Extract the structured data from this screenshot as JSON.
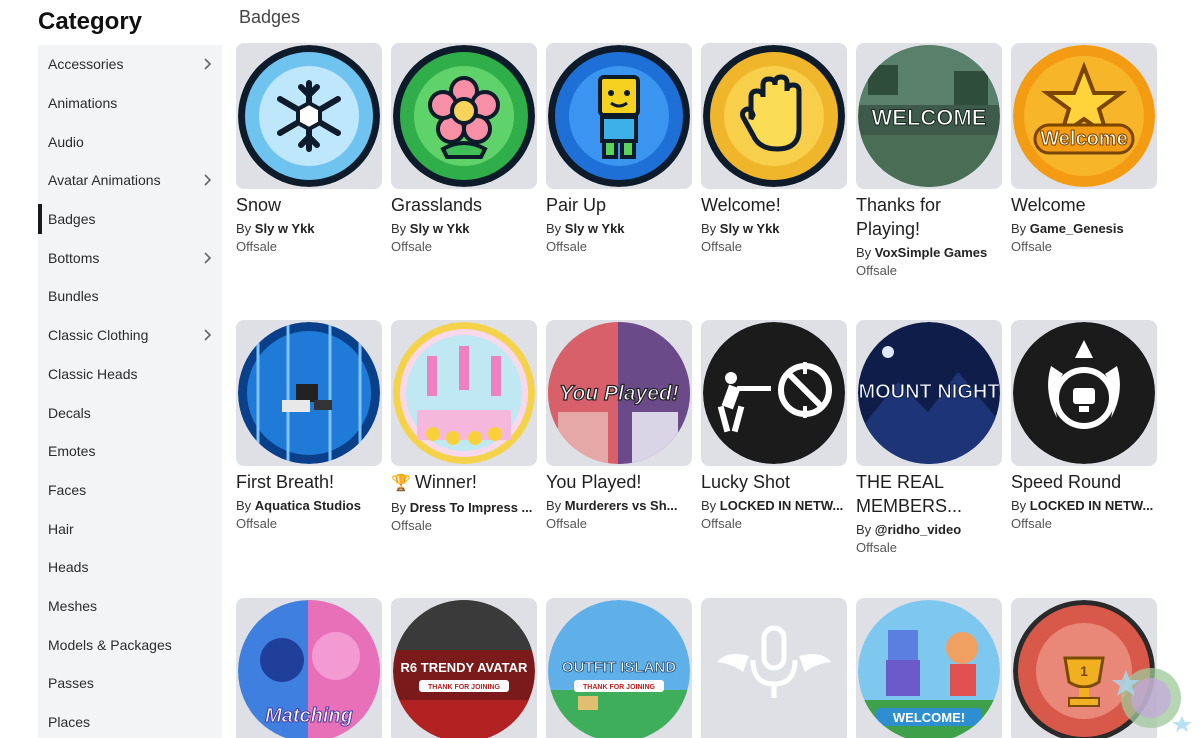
{
  "sidebar": {
    "title": "Category",
    "items": [
      {
        "label": "Accessories",
        "chevron": true
      },
      {
        "label": "Animations",
        "chevron": false
      },
      {
        "label": "Audio",
        "chevron": false
      },
      {
        "label": "Avatar Animations",
        "chevron": true
      },
      {
        "label": "Badges",
        "chevron": false,
        "active": true
      },
      {
        "label": "Bottoms",
        "chevron": true
      },
      {
        "label": "Bundles",
        "chevron": false
      },
      {
        "label": "Classic Clothing",
        "chevron": true
      },
      {
        "label": "Classic Heads",
        "chevron": false
      },
      {
        "label": "Decals",
        "chevron": false
      },
      {
        "label": "Emotes",
        "chevron": false
      },
      {
        "label": "Faces",
        "chevron": false
      },
      {
        "label": "Hair",
        "chevron": false
      },
      {
        "label": "Heads",
        "chevron": false
      },
      {
        "label": "Meshes",
        "chevron": false
      },
      {
        "label": "Models & Packages",
        "chevron": false
      },
      {
        "label": "Passes",
        "chevron": false
      },
      {
        "label": "Places",
        "chevron": false
      }
    ]
  },
  "main": {
    "section_title": "Badges",
    "by_prefix": "By ",
    "badges": [
      {
        "name": "Snow",
        "creator": "Sly w Ykk",
        "price": "Offsale",
        "icon": "snowflake-icon"
      },
      {
        "name": "Grasslands",
        "creator": "Sly w Ykk",
        "price": "Offsale",
        "icon": "flower-icon"
      },
      {
        "name": "Pair Up",
        "creator": "Sly w Ykk",
        "price": "Offsale",
        "icon": "avatar-icon"
      },
      {
        "name": "Welcome!",
        "creator": "Sly w Ykk",
        "price": "Offsale",
        "icon": "wave-hand-icon"
      },
      {
        "name": "Thanks for Playing!",
        "creator": "VoxSimple Games",
        "price": "Offsale",
        "icon": "welcome-sign-icon",
        "overlay": "WELCOME"
      },
      {
        "name": "Welcome",
        "creator": "Game_Genesis",
        "price": "Offsale",
        "icon": "star-icon",
        "overlay": "Welcome"
      },
      {
        "name": "First Breath!",
        "creator": "Aquatica Studios",
        "price": "Offsale",
        "icon": "underwater-icon"
      },
      {
        "name": "Winner!",
        "creator": "Dress To Impress ...",
        "price": "Offsale",
        "icon": "podium-icon",
        "prefix_glyph": "🏆"
      },
      {
        "name": "You Played!",
        "creator": "Murderers vs Sh...",
        "price": "Offsale",
        "icon": "characters-icon",
        "overlay": "You Played!"
      },
      {
        "name": "Lucky Shot",
        "creator": "LOCKED IN NETW...",
        "price": "Offsale",
        "icon": "sniper-icon"
      },
      {
        "name": "THE REAL MEMBERS...",
        "creator": "@ridho_video",
        "price": "Offsale",
        "icon": "mountain-icon",
        "overlay": "MOUNT NIGHT"
      },
      {
        "name": "Speed Round",
        "creator": "LOCKED IN NETW...",
        "price": "Offsale",
        "icon": "stopwatch-icon"
      },
      {
        "name": "",
        "creator": "",
        "price": "",
        "icon": "characters-pink-icon",
        "overlay": "Matching"
      },
      {
        "name": "",
        "creator": "",
        "price": "",
        "icon": "runway-icon",
        "overlay": "R6 TRENDY AVATAR",
        "overlay_sub": "THANK FOR JOINING"
      },
      {
        "name": "",
        "creator": "",
        "price": "",
        "icon": "island-icon",
        "overlay": "OUTFIT ISLAND",
        "overlay_sub": "THANK FOR JOINING"
      },
      {
        "name": "",
        "creator": "",
        "price": "",
        "icon": "microphone-wings-icon"
      },
      {
        "name": "",
        "creator": "",
        "price": "",
        "icon": "players-icon",
        "overlay": "WELCOME!"
      },
      {
        "name": "",
        "creator": "",
        "price": "",
        "icon": "trophy-icon",
        "overlay": "1"
      }
    ]
  },
  "colors": {
    "sidebar_bg": "#f3f4f6",
    "thumb_bg": "#dfe0e6",
    "active_bar": "#1a1a1a"
  }
}
